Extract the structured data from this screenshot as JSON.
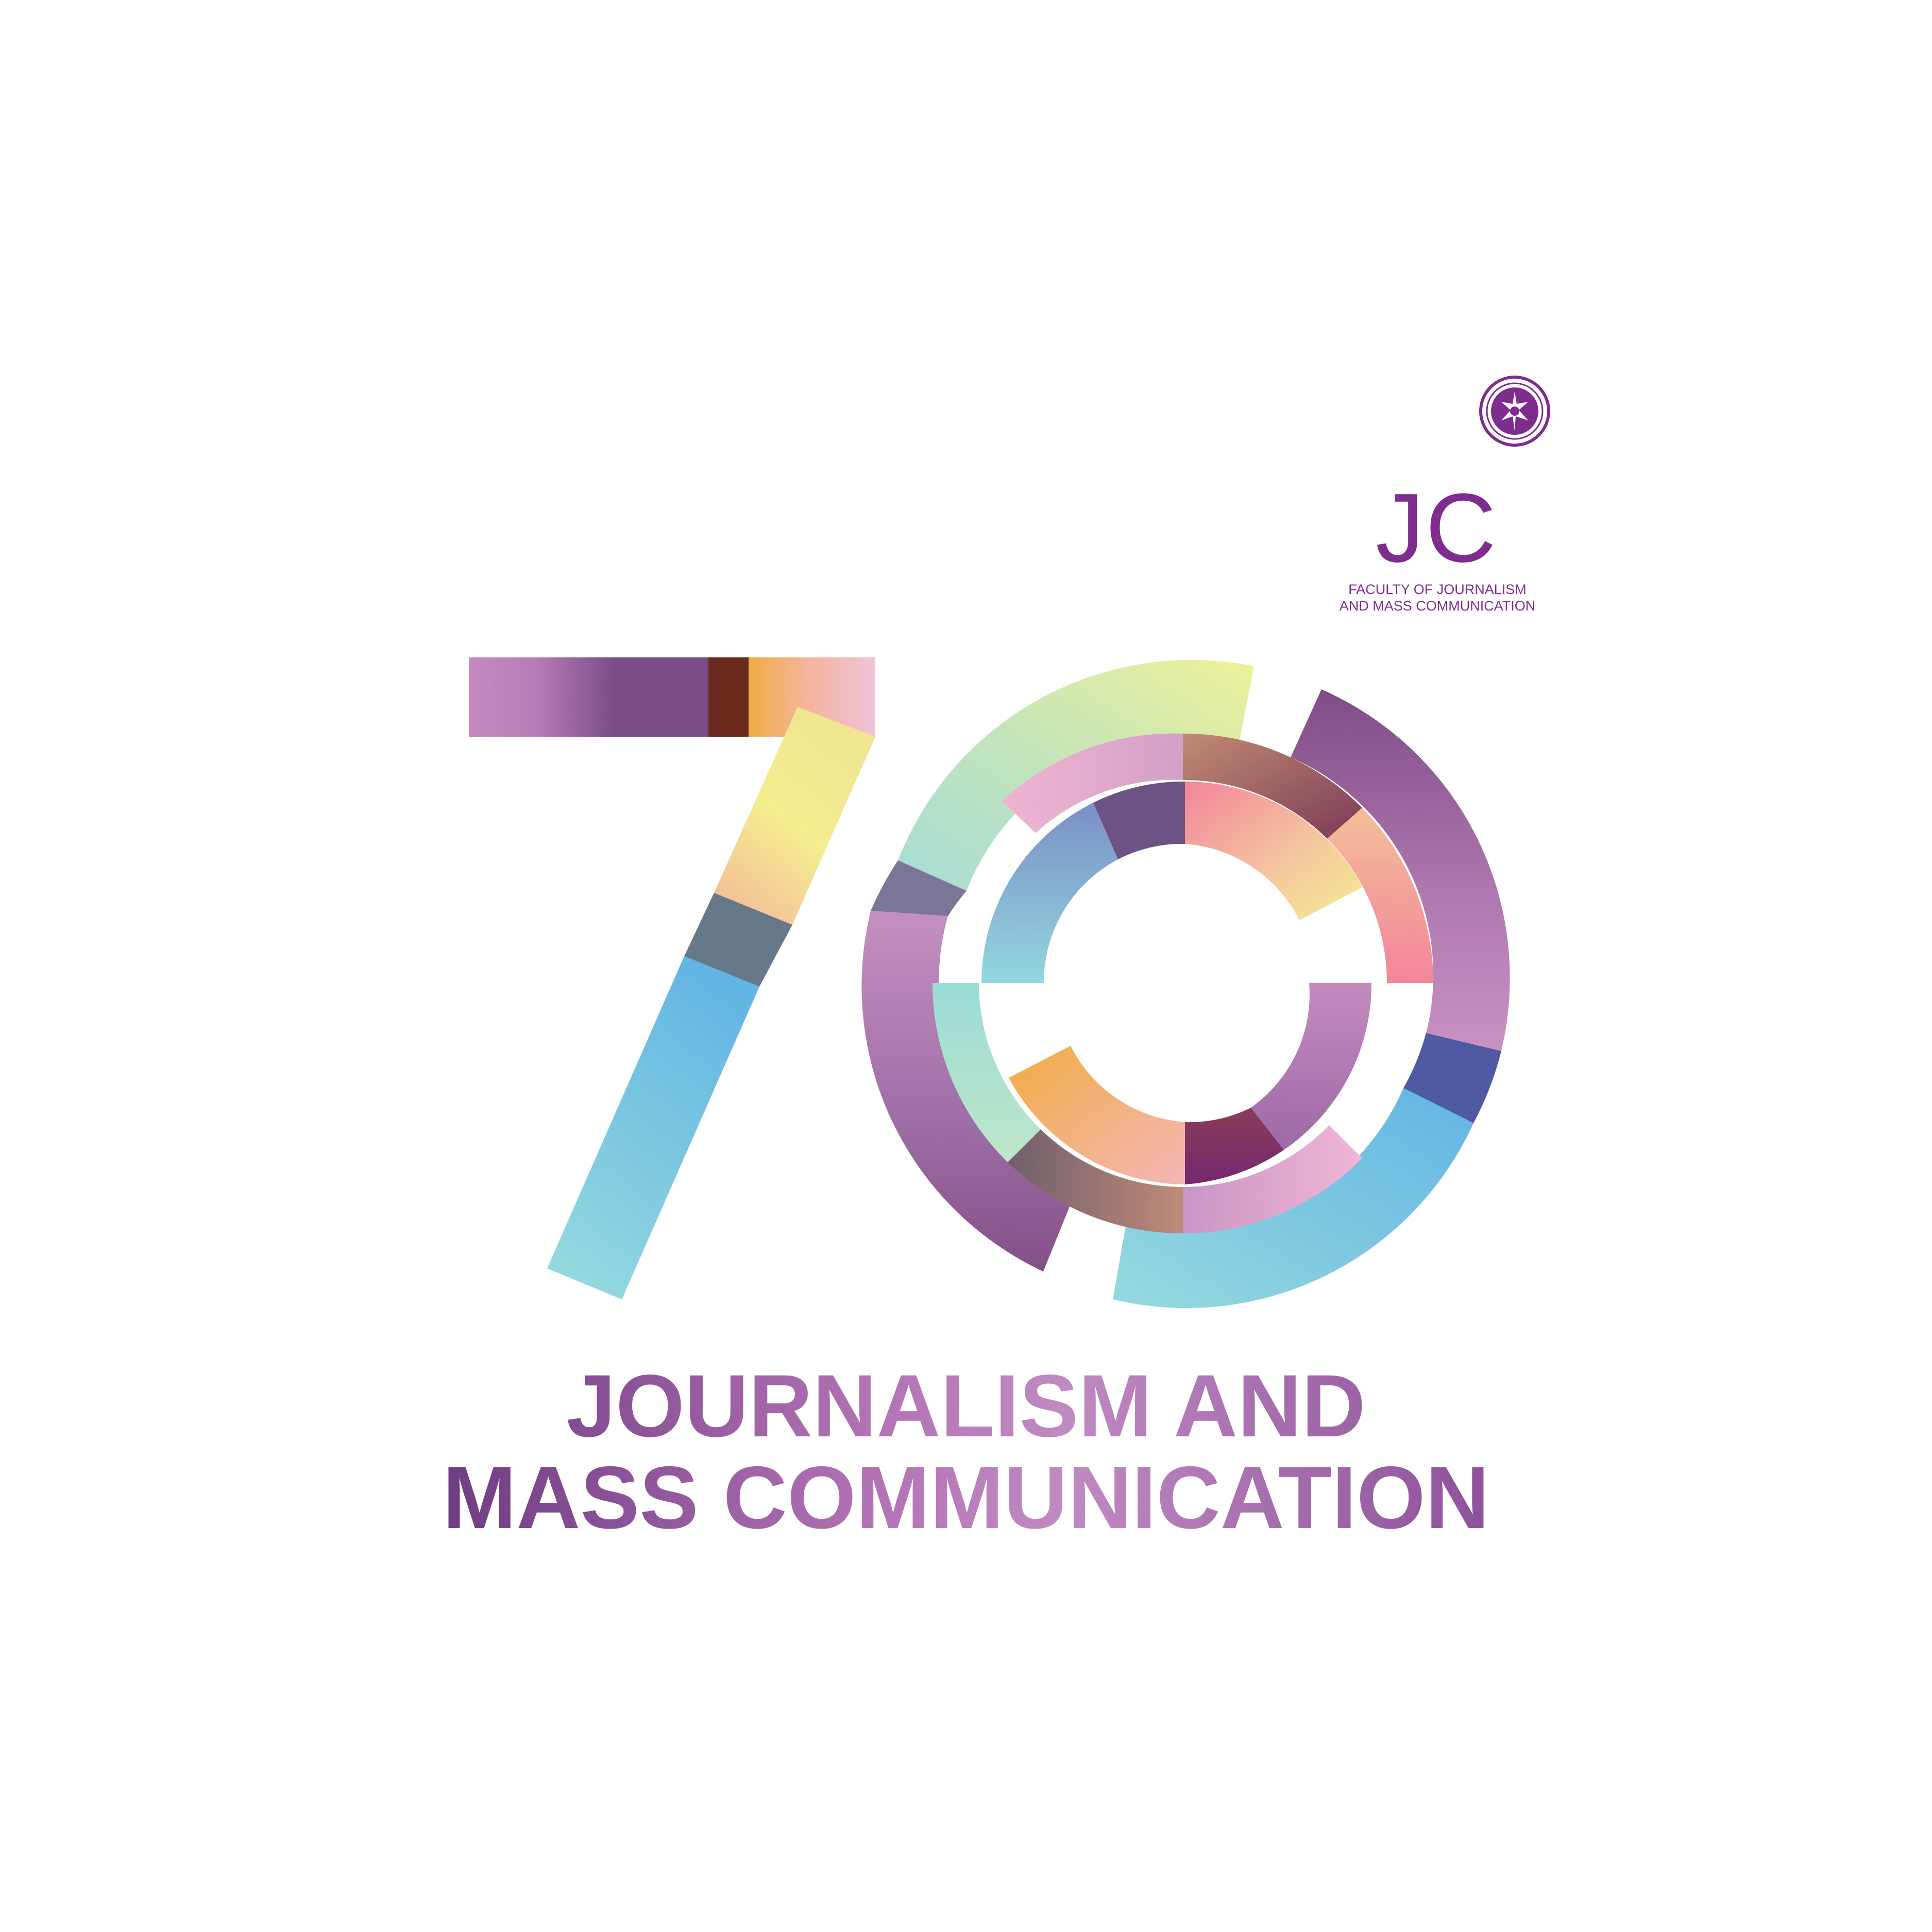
{
  "logo": {
    "mark": "JC",
    "faculty_line1": "FACULTY OF JOURNALISM",
    "faculty_line2": "AND MASS COMMUNICATION",
    "seal_icon": "university-seal-icon",
    "color": "#7e2c8e"
  },
  "numeral": {
    "text": "70",
    "palette": [
      "#c58ac0",
      "#7a4d87",
      "#6b2a1e",
      "#f2ad43",
      "#f4c3d0",
      "#f4ee8f",
      "#677889",
      "#62b4e4",
      "#93d9de",
      "#b0e2d3",
      "#eef19a",
      "#8c5590",
      "#4f5aa3",
      "#f3859a",
      "#74286d"
    ]
  },
  "headline": {
    "line1": "JOURNALISM AND",
    "line2": "MASS COMMUNICATION"
  }
}
